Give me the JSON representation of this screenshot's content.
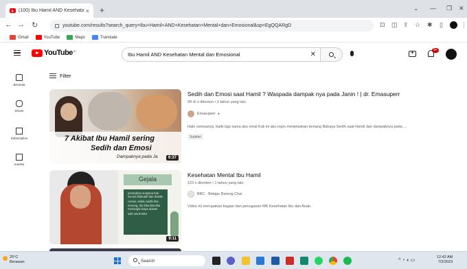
{
  "browser": {
    "tab_title": "(100) Ibu Hamil AND Kesehatan",
    "tab_close": "×",
    "new_tab": "+",
    "url": "youtube.com/results?search_query=Ibu+Hamil+AND+Kesehatan+Mental+dan+Emosional&sp=EgQQARgD",
    "bookmarks": [
      {
        "label": "Gmail",
        "color": "#ea4335"
      },
      {
        "label": "YouTube",
        "color": "#ff0000"
      },
      {
        "label": "Maps",
        "color": "#34a853"
      },
      {
        "label": "Translate",
        "color": "#4285f4"
      }
    ]
  },
  "youtube": {
    "logo_text": "YouTube",
    "logo_sup": "ID",
    "search_query": "Ibu Hamil AND Kesehatan Mental dan Emosional",
    "notification_count": "9+",
    "sidebar": [
      {
        "label": "Beranda",
        "icon": "home-icon"
      },
      {
        "label": "Shorts",
        "icon": "shorts-icon"
      },
      {
        "label": "Subscription",
        "icon": "subscriptions-icon"
      },
      {
        "label": "Koleksi",
        "icon": "library-icon"
      }
    ],
    "filter_label": "Filter",
    "results": [
      {
        "title": "Sedih dan Emosi saat Hamil ? Waspada dampak nya pada Janin ! | dr. Emasuperr",
        "meta": "99 rb x ditonton • 2 tahun yang lalu",
        "channel": "Emasuperr",
        "description": "Halo semuanya, balik lagi sama aku emal Kali ini aku ingin menjelaskan tentang Bahaya Sedih saat Hamil dan dampaknya pada ...",
        "badge": "Subtitel",
        "duration": "6:37",
        "thumb_text_1": "7 Akibat Ibu Hamil sering",
        "thumb_text_2": "Sedih dan Emosi",
        "thumb_text_3": "Dampaknya pada Ja"
      },
      {
        "title": "Kesehatan Mental Ibu Hamil",
        "meta": "123 x ditonton • 1 tahun yang lalu",
        "channel": "BBC - Belajar Bareng Chai",
        "description": "Video ini merupakan bagian dan penugasan MK Kesehatan Ibu dan Anak.",
        "duration": "9:11",
        "thumb_heading": "Gejala",
        "thumb_bullets": [
          "perubahan suasana hati secara fluktuatif dan drastis",
          "cemas, selalu sedih dan murung, Ibu bisa tiba-tiba menangis tanpa alasan",
          "sulit untuk tidur"
        ]
      }
    ]
  },
  "taskbar": {
    "weather_temp": "25°C",
    "weather_desc": "Berawan",
    "search_label": "Search",
    "time": "12:42 AM",
    "date": "7/2/2023"
  },
  "colors": {
    "yt_red": "#ff0000",
    "taskbar": "#dfe6ee"
  }
}
